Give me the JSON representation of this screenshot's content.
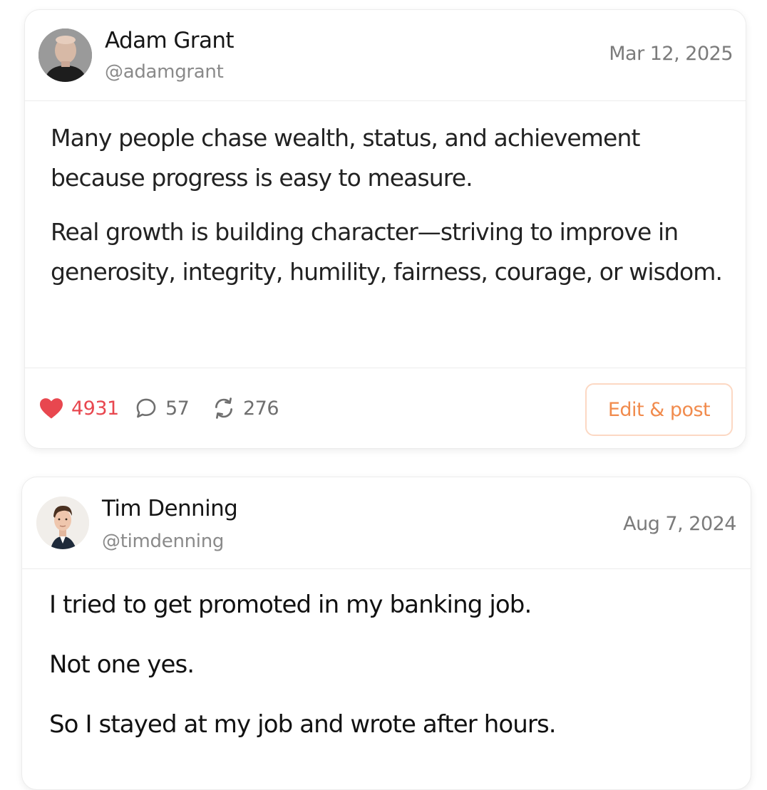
{
  "posts": [
    {
      "author_name": "Adam Grant",
      "author_handle": "@adamgrant",
      "date": "Mar 12, 2025",
      "paragraphs": [
        "Many people chase wealth, status, and achievement because progress is easy to measure.",
        "Real growth is building character—striving to improve in generosity, integrity, humility, fairness, courage, or wisdom."
      ],
      "likes": "4931",
      "comments": "57",
      "reposts": "276",
      "edit_label": "Edit & post",
      "icons": {
        "like": "heart-icon",
        "comment": "comment-bubble-icon",
        "repost": "repost-icon"
      }
    },
    {
      "author_name": "Tim Denning",
      "author_handle": "@timdenning",
      "date": "Aug 7, 2024",
      "paragraphs": [
        "I tried to get promoted in my banking job.",
        "Not one yes.",
        "So I stayed at my job and wrote after hours."
      ]
    }
  ],
  "colors": {
    "like": "#e8474f",
    "accent": "#f18b4d",
    "accent_border": "#fcd8c3",
    "muted_text": "#7b7b7b",
    "divider": "#ececec"
  }
}
